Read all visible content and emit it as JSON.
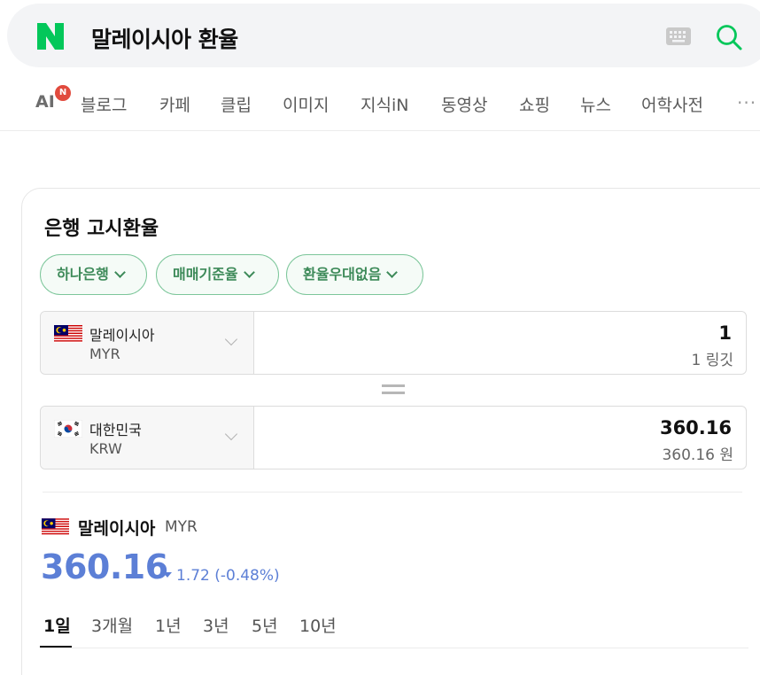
{
  "search": {
    "query": "말레이시아 환율"
  },
  "tabs": [
    {
      "label": "AI",
      "badge": "N"
    },
    {
      "label": "블로그"
    },
    {
      "label": "카페"
    },
    {
      "label": "클립"
    },
    {
      "label": "이미지"
    },
    {
      "label": "지식iN"
    },
    {
      "label": "동영상"
    },
    {
      "label": "쇼핑"
    },
    {
      "label": "뉴스"
    },
    {
      "label": "어학사전"
    }
  ],
  "more_label": "···",
  "converter": {
    "title": "은행 고시환율",
    "chips": [
      "하나은행",
      "매매기준율",
      "환율우대없음"
    ],
    "from": {
      "name": "말레이시아",
      "code": "MYR",
      "amount": "1",
      "amount_text": "1 링깃"
    },
    "to": {
      "name": "대한민국",
      "code": "KRW",
      "amount": "360.16",
      "amount_text": "360.16 원"
    }
  },
  "rate": {
    "name": "말레이시아",
    "code": "MYR",
    "value": "360.16",
    "change": "1.72 (-0.48%)"
  },
  "periods": [
    "1일",
    "3개월",
    "1년",
    "3년",
    "5년",
    "10년"
  ],
  "colors": {
    "brand_green": "#03c75a",
    "chip_green": "#3d8a59",
    "rate_blue": "#5c7fd6",
    "badge_red": "#e14a3d"
  }
}
